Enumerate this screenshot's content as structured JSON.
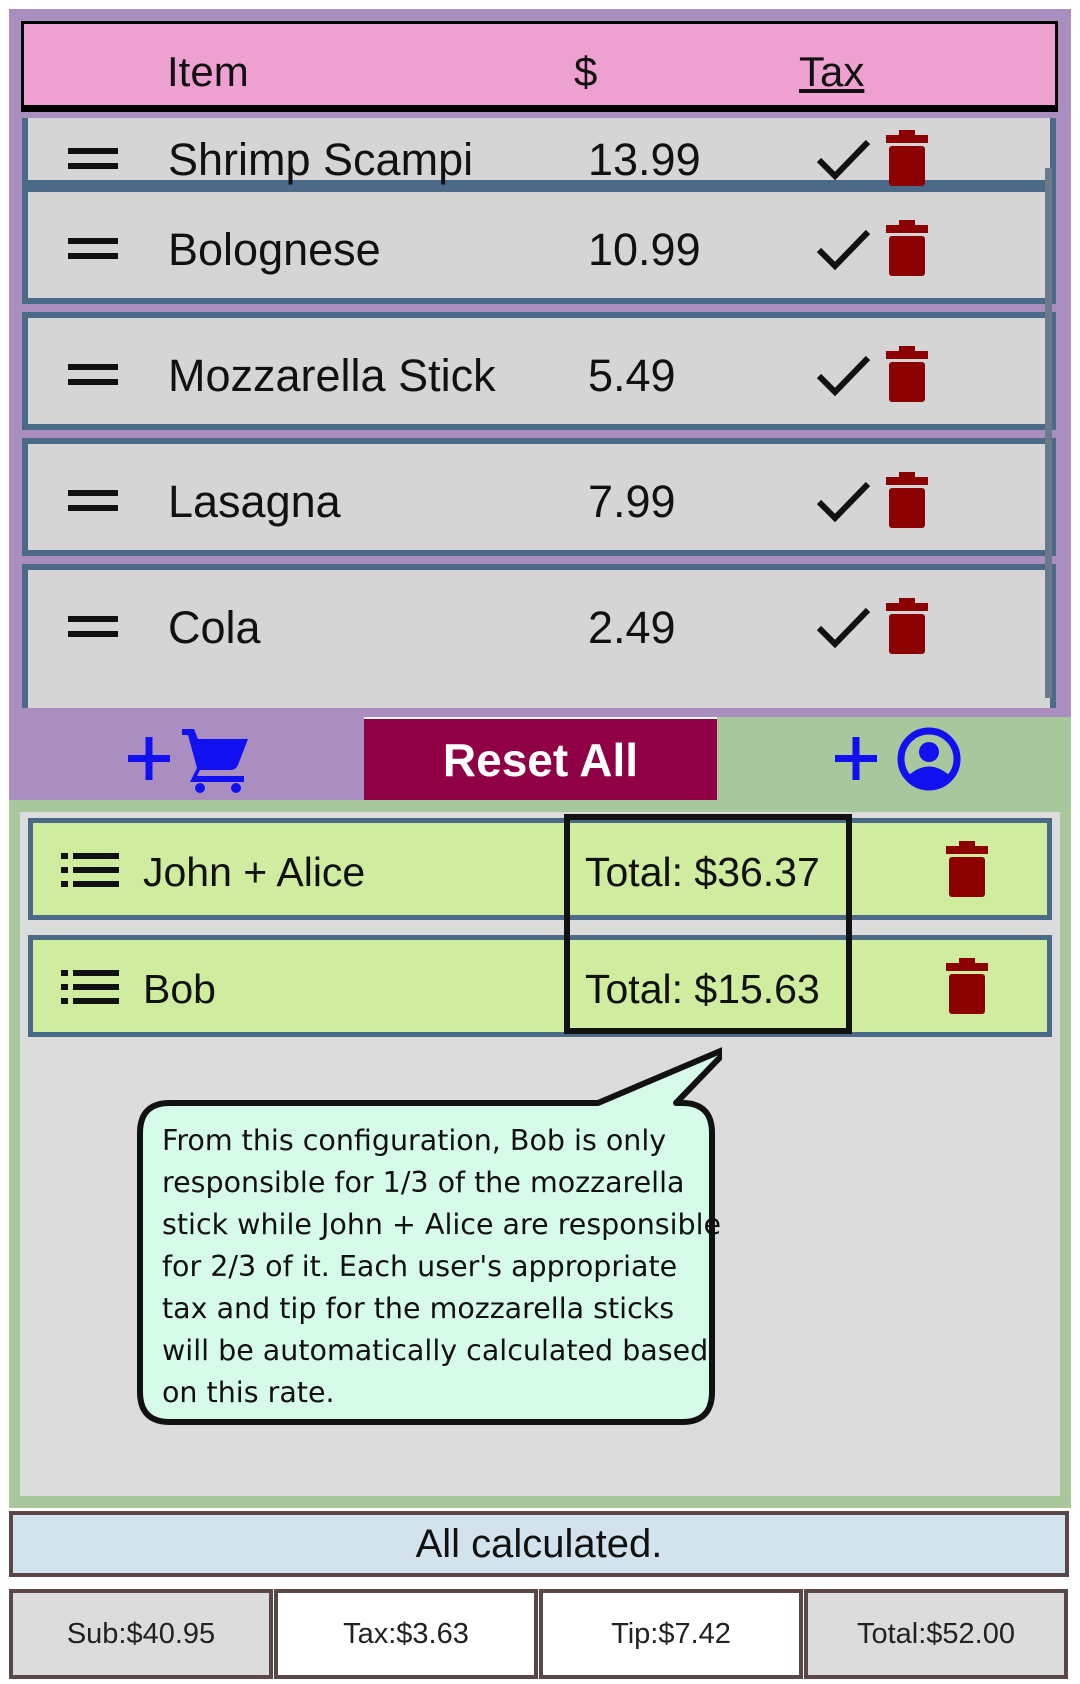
{
  "items_table": {
    "header": {
      "item_label": "Item",
      "price_label": "$",
      "tax_label": "Tax"
    },
    "rows": [
      {
        "name": "Shrimp Scampi",
        "price": "13.99",
        "taxed": true
      },
      {
        "name": "Bolognese",
        "price": "10.99",
        "taxed": true
      },
      {
        "name": "Mozzarella Stick",
        "price": "5.49",
        "taxed": true
      },
      {
        "name": "Lasagna",
        "price": "7.99",
        "taxed": true
      },
      {
        "name": "Cola",
        "price": "2.49",
        "taxed": true
      }
    ]
  },
  "actions": {
    "add_item_icons": [
      "plus-icon",
      "cart-icon"
    ],
    "reset_label": "Reset All",
    "add_user_icons": [
      "plus-icon",
      "account-icon"
    ]
  },
  "groups": [
    {
      "name": "John + Alice",
      "total": "Total: $36.37"
    },
    {
      "name": "Bob",
      "total": "Total: $15.63"
    }
  ],
  "callout": {
    "text": "From this configuration, Bob is only responsible for 1/3 of the mozzarella stick while John + Alice are responsible for 2/3 of it. Each user's appropriate tax and tip for the mozzarella sticks will be automatically calculated based on this rate."
  },
  "status": "All calculated.",
  "summary": {
    "sub": "Sub:$40.95",
    "tax": "Tax:$3.63",
    "tip": "Tip:$7.42",
    "total": "Total:$52.00"
  },
  "colors": {
    "items_panel": "#ab8ec0",
    "header_pink": "#eea0d0",
    "row_border": "#4b6a87",
    "trash": "#8b0000",
    "reset_button": "#8f0045",
    "groups_panel": "#a9c79c",
    "group_row": "#d0ec9f",
    "callout_fill": "#d6fbe9",
    "status_bar": "#d2e3ee",
    "icon_blue": "#1010f0"
  }
}
